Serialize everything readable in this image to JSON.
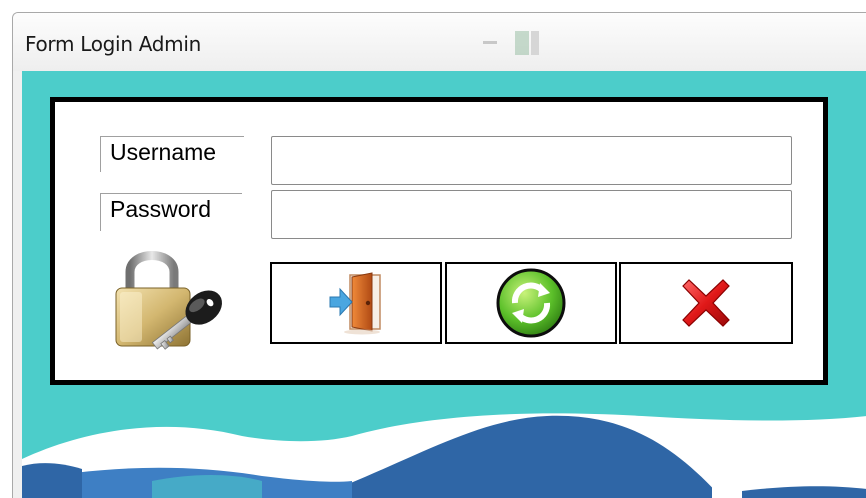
{
  "window": {
    "title": "Form Login Admin"
  },
  "form": {
    "username_label": "Username",
    "password_label": "Password",
    "username_value": "",
    "password_value": ""
  },
  "icons": {
    "title": "lock-and-key-icon",
    "login": "door-enter-icon",
    "refresh": "refresh-icon",
    "exit": "red-x-icon"
  },
  "colors": {
    "background": "#4ccdca",
    "panel_border": "#000000",
    "wave_dark": "#2f66a6",
    "wave_light": "#ffffff"
  }
}
